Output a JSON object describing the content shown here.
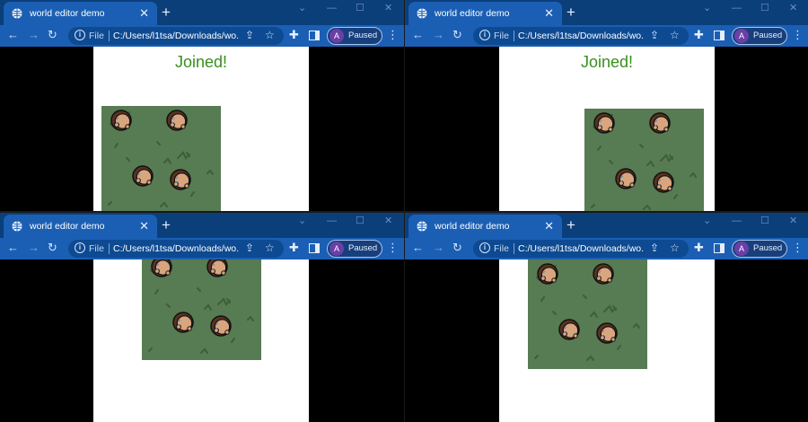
{
  "windows": [
    {
      "id": "win-tl",
      "tab": {
        "title": "world editor demo"
      },
      "toolbar": {
        "scheme": "File",
        "url": "C:/Users/l1tsa/Downloads/wo...",
        "profile_label": "Paused",
        "profile_initial": "A"
      },
      "content": {
        "status": "Joined!"
      }
    },
    {
      "id": "win-tr",
      "tab": {
        "title": "world editor demo"
      },
      "toolbar": {
        "scheme": "File",
        "url": "C:/Users/l1tsa/Downloads/wo...",
        "profile_label": "Paused",
        "profile_initial": "A"
      },
      "content": {
        "status": "Joined!"
      }
    },
    {
      "id": "win-bl",
      "tab": {
        "title": "world editor demo"
      },
      "toolbar": {
        "scheme": "File",
        "url": "C:/Users/l1tsa/Downloads/wo...",
        "profile_label": "Paused",
        "profile_initial": "A"
      },
      "content": {
        "status": ""
      }
    },
    {
      "id": "win-br",
      "tab": {
        "title": "world editor demo"
      },
      "toolbar": {
        "scheme": "File",
        "url": "C:/Users/l1tsa/Downloads/wo...",
        "profile_label": "Paused",
        "profile_initial": "A"
      },
      "content": {
        "status": ""
      }
    }
  ],
  "theme": {
    "tabbar": "#0b3f7a",
    "toolbar": "#1b5fb4",
    "grass": "#577b52",
    "status_text": "#3a8e1f",
    "skin": "#d9a57e",
    "hair": "#5a3220"
  },
  "icons": {
    "favicon": "globe-icon",
    "back": "arrow-left-icon",
    "forward": "arrow-right-icon",
    "reload": "reload-icon",
    "info": "info-icon",
    "share": "share-icon",
    "bookmark": "star-icon",
    "extensions": "puzzle-icon",
    "side_panel": "side-panel-icon",
    "menu": "kebab-menu-icon"
  }
}
